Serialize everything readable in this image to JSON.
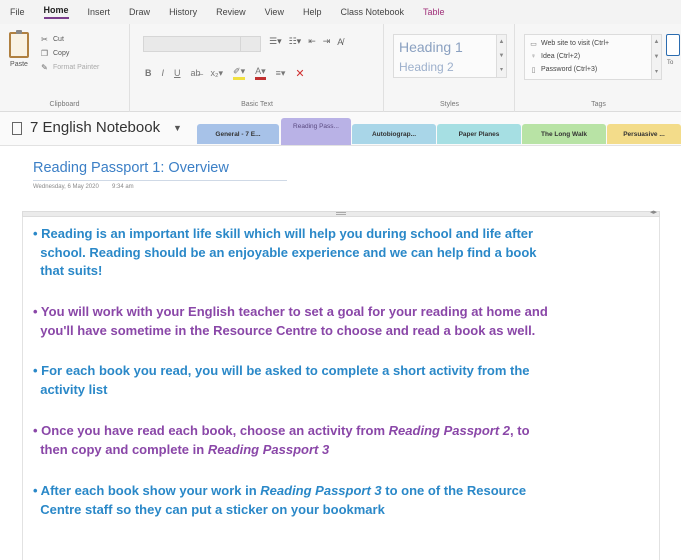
{
  "menu": {
    "items": [
      "File",
      "Home",
      "Insert",
      "Draw",
      "History",
      "Review",
      "View",
      "Help",
      "Class Notebook",
      "Table"
    ],
    "active": "Home"
  },
  "ribbon": {
    "clipboard": {
      "paste_label": "Paste",
      "cut_label": "Cut",
      "copy_label": "Copy",
      "format_painter_label": "Format Painter",
      "group_label": "Clipboard"
    },
    "basic_text": {
      "group_label": "Basic Text"
    },
    "styles": {
      "heading1": "Heading 1",
      "heading2": "Heading 2",
      "group_label": "Styles"
    },
    "tags": {
      "items": [
        "Web site to visit (Ctrl+",
        "Idea (Ctrl+2)",
        "Password (Ctrl+3)"
      ],
      "todo_label": "To",
      "group_label": "Tags"
    }
  },
  "notebook": {
    "title": "7 English Notebook",
    "sections": [
      {
        "label": "General - 7 E...",
        "color": "#a7c2e8"
      },
      {
        "label": "Reading Pass...",
        "color": "#b9b2e6"
      },
      {
        "label": "Autobiograp...",
        "color": "#a9d6e8"
      },
      {
        "label": "Paper Planes",
        "color": "#a6dfe3"
      },
      {
        "label": "The Long Walk",
        "color": "#b8e3a5"
      },
      {
        "label": "Persuasive ...",
        "color": "#f3dc8a"
      }
    ],
    "active_section_index": 1
  },
  "page": {
    "title": "Reading Passport 1: Overview",
    "date": "Wednesday, 6 May 2020",
    "time": "9:34 am",
    "paragraphs": [
      {
        "color": "#2a88c8",
        "lines": [
          [
            {
              "t": "• Reading is an important life skill which will help you during school and life after"
            }
          ],
          [
            {
              "t": "  school. Reading should be an enjoyable experience and we can help find a book"
            }
          ],
          [
            {
              "t": "  that suits!"
            }
          ]
        ]
      },
      {
        "color": "#8a47a8",
        "lines": [
          [
            {
              "t": "• You will work with your English teacher to set a goal for your reading at home and"
            }
          ],
          [
            {
              "t": "  you'll have sometime in the Resource Centre to choose and read a book as well."
            }
          ]
        ]
      },
      {
        "color": "#2a88c8",
        "lines": [
          [
            {
              "t": "• For each book you read, you will be asked to complete a short activity from the"
            }
          ],
          [
            {
              "t": "  activity list"
            }
          ]
        ]
      },
      {
        "color": "#8a47a8",
        "lines": [
          [
            {
              "t": "• Once you have read each book, choose an activity from "
            },
            {
              "t": "Reading Passport 2",
              "i": true
            },
            {
              "t": ", to"
            }
          ],
          [
            {
              "t": "  then copy and complete in "
            },
            {
              "t": "Reading Passport 3",
              "i": true
            }
          ]
        ]
      },
      {
        "color": "#2a88c8",
        "lines": [
          [
            {
              "t": "• After each book show your work in "
            },
            {
              "t": "Reading Passport 3",
              "i": true
            },
            {
              "t": " to one of the Resource"
            }
          ],
          [
            {
              "t": "  Centre staff so they can put a sticker on your bookmark"
            }
          ]
        ]
      }
    ]
  }
}
